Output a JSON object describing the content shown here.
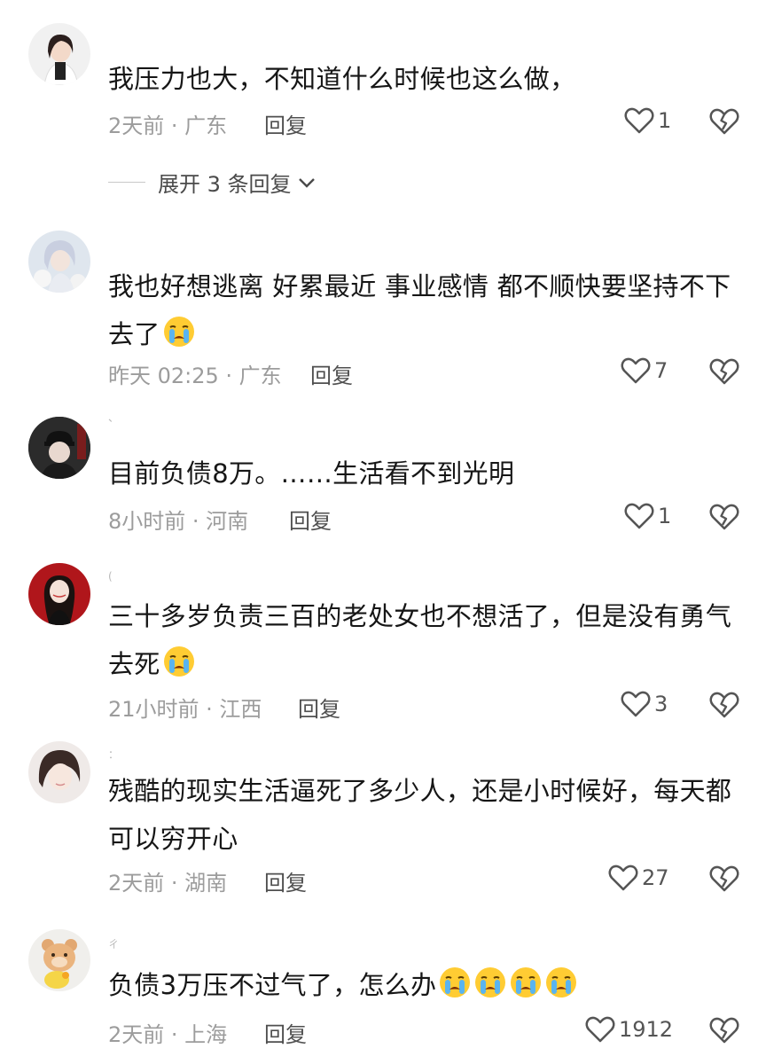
{
  "comments": [
    {
      "username": "",
      "text": "我压力也大，不知道什么时候也这么做，",
      "text2": "",
      "emoji_count": 0,
      "time_location": "2天前 · 广东",
      "reply_label": "回复",
      "like_count": "1",
      "avatar_icon": "avatar-woman-photo"
    },
    {
      "username": "",
      "text": "我也好想逃离 好累最近 事业感情 都不顺快要坚持不下",
      "text2": "去了",
      "emoji_count": 1,
      "time_location": "昨天 02:25 · 广东",
      "reply_label": "回复",
      "like_count": "7",
      "avatar_icon": "avatar-anime-girl"
    },
    {
      "username": "、",
      "text": "目前负债8万。……生活看不到光明",
      "text2": "",
      "emoji_count": 0,
      "time_location": "8小时前 · 河南",
      "reply_label": "回复",
      "like_count": "1",
      "avatar_icon": "avatar-man-cap"
    },
    {
      "username": "(",
      "text": "三十多岁负责三百的老处女也不想活了，但是没有勇气",
      "text2": "去死",
      "emoji_count": 1,
      "time_location": "21小时前 · 江西",
      "reply_label": "回复",
      "like_count": "3",
      "avatar_icon": "avatar-woman-red"
    },
    {
      "username": "：",
      "text": "残酷的现实生活逼死了多少人，还是小时候好，每天都",
      "text2": "可以穷开心",
      "emoji_count": 0,
      "time_location": "2天前 · 湖南",
      "reply_label": "回复",
      "like_count": "27",
      "avatar_icon": "avatar-woman-selfie"
    },
    {
      "username": "ㄔ",
      "text": "负债3万压不过气了，怎么办",
      "text2": "",
      "emoji_count": 4,
      "time_location": "2天前 · 上海",
      "reply_label": "回复",
      "like_count": "1912",
      "avatar_icon": "avatar-cartoon-bear"
    }
  ],
  "expand_replies": {
    "label": "展开 3 条回复"
  },
  "icons": {
    "like": "heart-outline-icon",
    "dislike": "broken-heart-icon",
    "emoji": "crying-face-emoji"
  }
}
